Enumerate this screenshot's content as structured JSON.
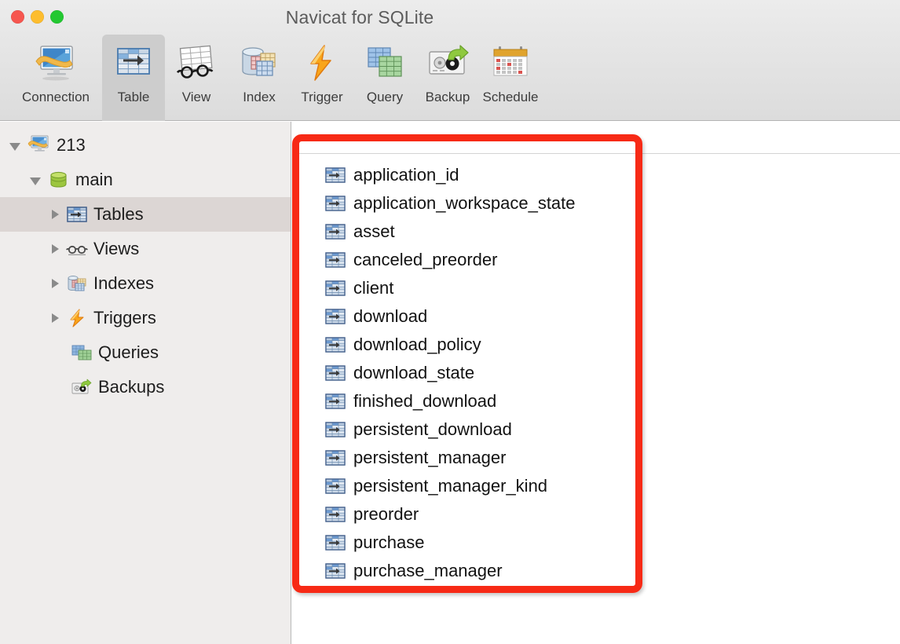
{
  "window": {
    "title": "Navicat for SQLite",
    "controls": [
      {
        "name": "close",
        "color": "#f6564f"
      },
      {
        "name": "minimize",
        "color": "#fdbd2e"
      },
      {
        "name": "zoom",
        "color": "#23c831"
      }
    ]
  },
  "toolbar": {
    "items": [
      {
        "label": "Connection",
        "icon": "connection-icon",
        "selected": false
      },
      {
        "label": "Table",
        "icon": "table-icon",
        "selected": true
      },
      {
        "label": "View",
        "icon": "view-icon",
        "selected": false
      },
      {
        "label": "Index",
        "icon": "index-icon",
        "selected": false
      },
      {
        "label": "Trigger",
        "icon": "trigger-icon",
        "selected": false
      },
      {
        "label": "Query",
        "icon": "query-icon",
        "selected": false
      },
      {
        "label": "Backup",
        "icon": "backup-icon",
        "selected": false
      },
      {
        "label": "Schedule",
        "icon": "schedule-icon",
        "selected": false
      }
    ]
  },
  "sidebar": {
    "items": [
      {
        "label": "213",
        "icon": "connection-icon",
        "level": 0,
        "expanded": true,
        "hasChildren": true,
        "selected": false
      },
      {
        "label": "main",
        "icon": "database-icon",
        "level": 1,
        "expanded": true,
        "hasChildren": true,
        "selected": false
      },
      {
        "label": "Tables",
        "icon": "tables-icon",
        "level": 2,
        "expanded": false,
        "hasChildren": true,
        "selected": true
      },
      {
        "label": "Views",
        "icon": "views-icon",
        "level": 2,
        "expanded": false,
        "hasChildren": true,
        "selected": false
      },
      {
        "label": "Indexes",
        "icon": "indexes-icon",
        "level": 2,
        "expanded": false,
        "hasChildren": true,
        "selected": false
      },
      {
        "label": "Triggers",
        "icon": "triggers-icon",
        "level": 2,
        "expanded": false,
        "hasChildren": true,
        "selected": false
      },
      {
        "label": "Queries",
        "icon": "queries-icon",
        "level": 2,
        "expanded": false,
        "hasChildren": false,
        "selected": false
      },
      {
        "label": "Backups",
        "icon": "backups-icon",
        "level": 2,
        "expanded": false,
        "hasChildren": false,
        "selected": false
      }
    ]
  },
  "main": {
    "object_type": "table",
    "tables": [
      "application_id",
      "application_workspace_state",
      "asset",
      "canceled_preorder",
      "client",
      "download",
      "download_policy",
      "download_state",
      "finished_download",
      "persistent_download",
      "persistent_manager",
      "persistent_manager_kind",
      "preorder",
      "purchase",
      "purchase_manager"
    ]
  },
  "annotation": {
    "shape": "rounded-rectangle",
    "color": "#f72a16",
    "stroke_width": 9
  }
}
